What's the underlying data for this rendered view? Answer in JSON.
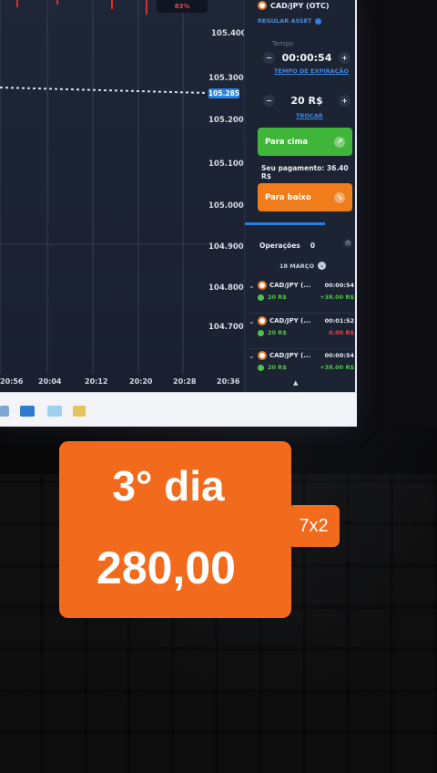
{
  "chart": {
    "top_badge": "83%",
    "price_tag": "105.285",
    "y_labels": [
      "105.400",
      "105.300",
      "105.200",
      "105.100",
      "105.000",
      "104.900",
      "104.800",
      "104.700"
    ],
    "x_labels": [
      "20:56",
      "20:04",
      "20:12",
      "20:20",
      "20:28",
      "20:36"
    ]
  },
  "panel": {
    "asset": "CAD/JPY (OTC)",
    "regular_asset": "REGULAR ASSET",
    "time_label": "Tempo",
    "time_value": "00:00:54",
    "time_mode_link": "TEMPO DE EXPIRAÇÃO",
    "amount_value": "20 R$",
    "amount_link": "TROCAR",
    "up_button": "Para cima",
    "payout": "Seu pagamento: 36.40 R$",
    "down_button": "Para baixo",
    "ops_title": "Operações",
    "ops_count": "0",
    "ops_date": "18 MARÇO",
    "trades": [
      {
        "name": "CAD/JPY (...",
        "time": "00:00:54",
        "amount": "20 R$",
        "result": "+38.00 R$",
        "win": true
      },
      {
        "name": "CAD/JPY (...",
        "time": "00:01:52",
        "amount": "20 R$",
        "result": "0.00 R$",
        "win": false
      },
      {
        "name": "CAD/JPY (...",
        "time": "00:00:54",
        "amount": "20 R$",
        "result": "+38.00 R$",
        "win": true
      }
    ]
  },
  "overlay": {
    "line1": "3° dia",
    "line2": "280,00",
    "multiplier": "7x2"
  },
  "colors": {
    "accent_orange": "#f26a1b",
    "up_green": "#3fb63a",
    "down_orange": "#f07d1a",
    "link_blue": "#3f86df"
  }
}
